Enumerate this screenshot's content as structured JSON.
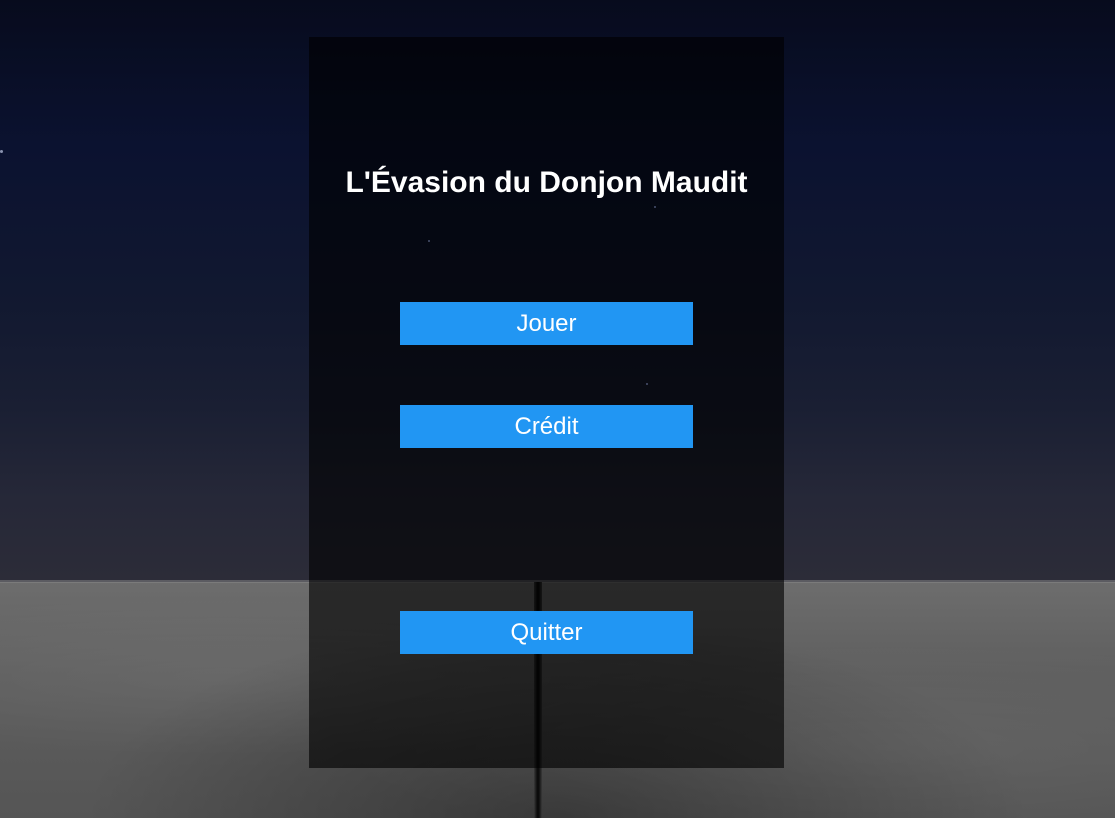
{
  "game": {
    "title": "L'Évasion du Donjon Maudit"
  },
  "menu": {
    "play_label": "Jouer",
    "credit_label": "Crédit",
    "quit_label": "Quitter"
  },
  "colors": {
    "button_bg": "#2196f3",
    "button_text": "#ffffff",
    "title_text": "#ffffff",
    "panel_bg": "#000000"
  }
}
